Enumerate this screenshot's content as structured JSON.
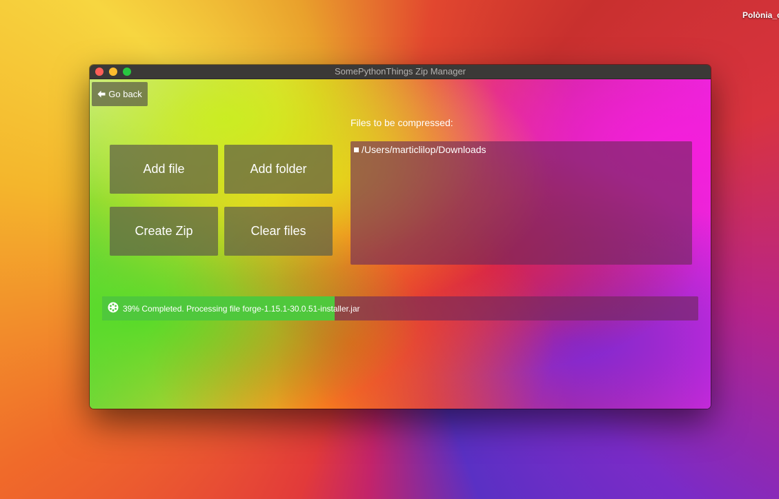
{
  "desktop": {
    "label": "Polònia_c"
  },
  "window": {
    "title": "SomePythonThings Zip Manager"
  },
  "toolbar": {
    "back_label": "Go back"
  },
  "actions": {
    "add_file": "Add file",
    "add_folder": "Add folder",
    "create_zip": "Create Zip",
    "clear_files": "Clear files"
  },
  "files": {
    "label": "Files to be compressed:",
    "items": [
      {
        "path": "/Users/marticlilop/Downloads",
        "icon": "folder-bullet-icon"
      }
    ]
  },
  "progress": {
    "percent": 39,
    "text": "39% Completed. Processing file forge-1.15.1-30.0.51-installer.jar",
    "icon": "spinner-icon",
    "fill_color": "#4fc83c"
  },
  "colors": {
    "titlebar": "#3b3937",
    "close": "#fe5f57",
    "minimize": "#febc2e",
    "maximize": "#28c840"
  }
}
